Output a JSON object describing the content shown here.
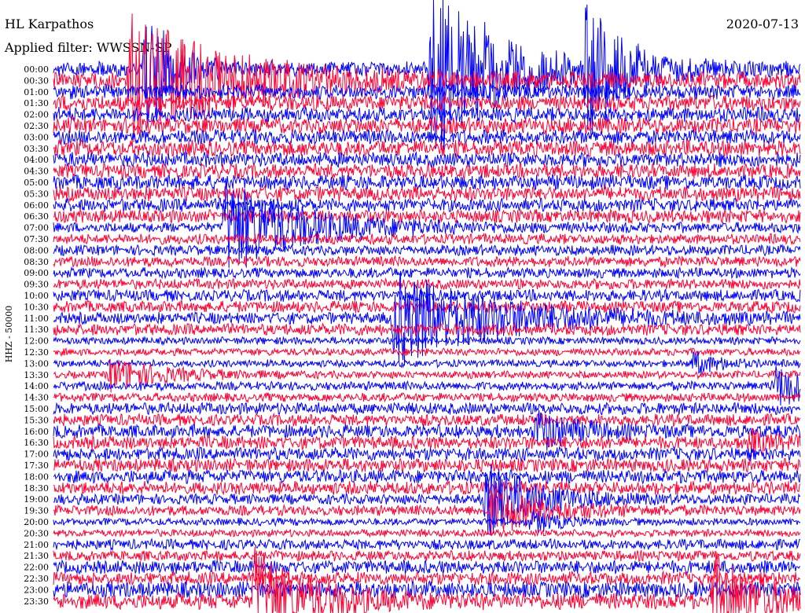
{
  "header": {
    "station": "HL Karpathos",
    "date": "2020-07-13",
    "filter": "Applied filter: WWSSN-SP"
  },
  "chart_data": {
    "type": "line",
    "title": "",
    "ylabel": "HHZ - 50000",
    "xlabel": "",
    "colors": [
      "#0000ff",
      "#ff0033"
    ],
    "hours": [
      "00:00",
      "00:30",
      "01:00",
      "01:30",
      "02:00",
      "02:30",
      "03:00",
      "03:30",
      "04:00",
      "04:30",
      "05:00",
      "05:30",
      "06:00",
      "06:30",
      "07:00",
      "07:30",
      "08:00",
      "08:30",
      "09:00",
      "09:30",
      "10:00",
      "10:30",
      "11:00",
      "11:30",
      "12:00",
      "12:30",
      "13:00",
      "13:30",
      "14:00",
      "14:30",
      "15:00",
      "15:30",
      "16:00",
      "16:30",
      "17:00",
      "17:30",
      "18:00",
      "18:30",
      "19:00",
      "19:30",
      "20:00",
      "20:30",
      "21:00",
      "21:30",
      "22:00",
      "22:30",
      "23:00",
      "23:30"
    ],
    "trace_amplitude": [
      10,
      11,
      10,
      11,
      10,
      11,
      10,
      11,
      10,
      10,
      10,
      10,
      9,
      9,
      7,
      7,
      7,
      7,
      7,
      7,
      8,
      8,
      8,
      8,
      5,
      5,
      5,
      5,
      6,
      6,
      8,
      8,
      9,
      9,
      9,
      9,
      9,
      9,
      7,
      7,
      5,
      5,
      7,
      7,
      9,
      9,
      11,
      11
    ],
    "events": [
      {
        "hour": "00:00",
        "minute": 15.2,
        "amplitude": 120,
        "decay_minutes": 2.5
      },
      {
        "hour": "00:00",
        "minute": 3.7,
        "amplitude": 90,
        "decay_minutes": 1
      },
      {
        "hour": "00:00",
        "minute": 21.4,
        "amplitude": 80,
        "decay_minutes": 1.5
      },
      {
        "hour": "23:30",
        "minute": 8.1,
        "amplitude": 70,
        "decay_minutes": 2
      },
      {
        "hour": "23:30",
        "minute": 26.5,
        "amplitude": 60,
        "decay_minutes": 2
      },
      {
        "hour": "00:30",
        "minute": 3.1,
        "amplitude": 80,
        "decay_minutes": 4
      },
      {
        "hour": "07:00",
        "minute": 6.9,
        "amplitude": 60,
        "decay_minutes": 3
      },
      {
        "hour": "13:30",
        "minute": 2.3,
        "amplitude": 20,
        "decay_minutes": 2
      },
      {
        "hour": "11:00",
        "minute": 13.7,
        "amplitude": 60,
        "decay_minutes": 4
      },
      {
        "hour": "14:00",
        "minute": 29.0,
        "amplitude": 25,
        "decay_minutes": 2
      },
      {
        "hour": "19:00",
        "minute": 17.4,
        "amplitude": 45,
        "decay_minutes": 2
      },
      {
        "hour": "19:30",
        "minute": 17.6,
        "amplitude": 30,
        "decay_minutes": 2
      },
      {
        "hour": "16:00",
        "minute": 19.4,
        "amplitude": 25,
        "decay_minutes": 1.5
      },
      {
        "hour": "13:00",
        "minute": 25.7,
        "amplitude": 14,
        "decay_minutes": 1
      },
      {
        "hour": "16:30",
        "minute": 28.0,
        "amplitude": 12,
        "decay_minutes": 1
      },
      {
        "hour": "20:00",
        "minute": 19.2,
        "amplitude": 14,
        "decay_minutes": 1
      }
    ]
  }
}
